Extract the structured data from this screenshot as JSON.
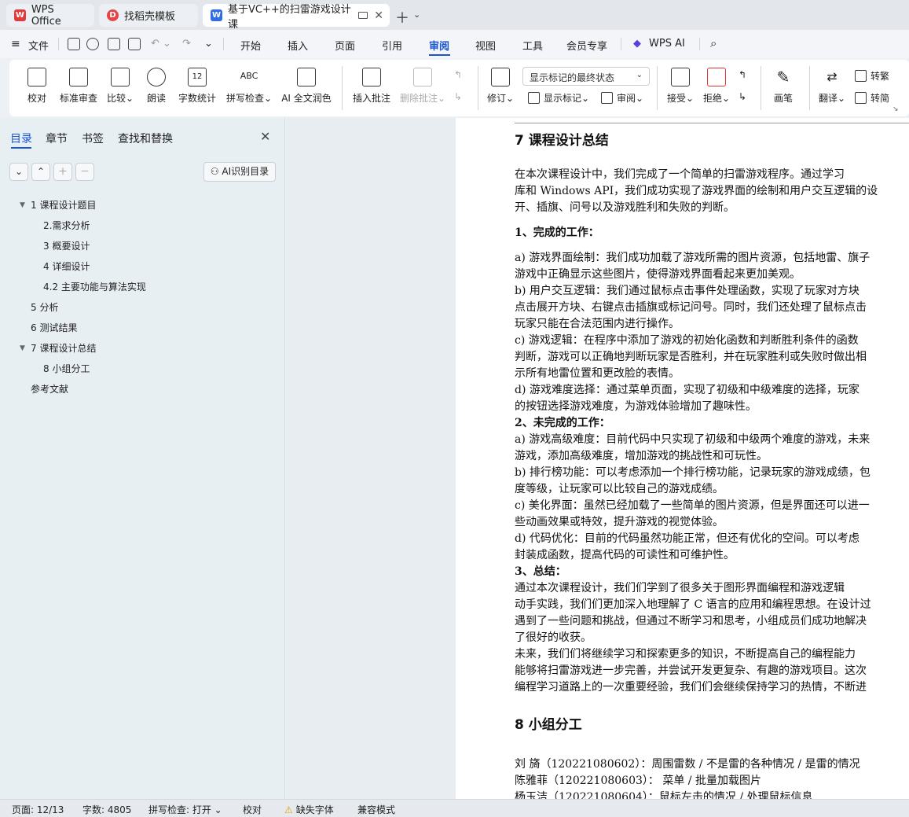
{
  "tabs": [
    {
      "label": "WPS Office",
      "logo": "W"
    },
    {
      "label": "找稻壳模板",
      "logo": "D"
    },
    {
      "label": "基于VC++的扫雷游戏设计 课",
      "logo": "W"
    }
  ],
  "menu": {
    "file": "文件",
    "items": [
      "开始",
      "插入",
      "页面",
      "引用",
      "审阅",
      "视图",
      "工具",
      "会员专享"
    ],
    "selected": "审阅",
    "ai": "WPS AI"
  },
  "ribbon": {
    "buttons": [
      {
        "label": "校对",
        "icon": "proofread-icon"
      },
      {
        "label": "标准审查",
        "icon": "standard-review-icon"
      },
      {
        "label": "比较",
        "icon": "compare-icon"
      },
      {
        "label": "朗读",
        "icon": "read-aloud-icon"
      },
      {
        "label": "字数统计",
        "icon": "word-count-icon"
      },
      {
        "label": "拼写检查",
        "icon": "spell-check-icon"
      },
      {
        "label": "AI 全文润色",
        "icon": "ai-polish-icon"
      },
      {
        "label": "插入批注",
        "icon": "insert-comment-icon"
      },
      {
        "label": "删除批注",
        "icon": "delete-comment-icon"
      }
    ],
    "dropdown_value": "显示标记的最终状态",
    "revise": "修订",
    "show_markup": "显示标记",
    "review": "审阅",
    "accept": "接受",
    "reject": "拒绝",
    "pen": "画笔",
    "translate": "翻译",
    "to_traditional": "转繁",
    "to_simplified": "转简",
    "icon_text": "ABC",
    "count_icon_text": "12"
  },
  "sidebar": {
    "tabs": [
      "目录",
      "章节",
      "书签",
      "查找和替换"
    ],
    "ai_button": "AI识别目录",
    "toc": [
      {
        "label": "1  课程设计题目",
        "level": 1,
        "expanded": true
      },
      {
        "label": "2.需求分析",
        "level": 2
      },
      {
        "label": "3  概要设计",
        "level": 2
      },
      {
        "label": "4 详细设计",
        "level": 2
      },
      {
        "label": "4.2  主要功能与算法实现",
        "level": 2
      },
      {
        "label": "5  分析",
        "level": 1
      },
      {
        "label": "6  测试结果",
        "level": 1
      },
      {
        "label": "7   课程设计总结",
        "level": 1,
        "expanded": true
      },
      {
        "label": "8  小组分工",
        "level": 2
      },
      {
        "label": "参考文献",
        "level": 1
      }
    ]
  },
  "document": {
    "heading7": "7   课程设计总结",
    "lines": [
      "     在本次课程设计中，我们完成了一个简单的扫雷游戏程序。通过学习",
      "库和 Windows API，我们成功实现了游戏界面的绘制和用户交互逻辑的设",
      "开、插旗、问号以及游戏胜利和失败的判断。",
      "1、完成的工作：",
      "a) 游戏界面绘制：我们成功加载了游戏所需的图片资源，包括地雷、旗子",
      "游戏中正确显示这些图片，使得游戏界面看起来更加美观。",
      "b) 用户交互逻辑：我们通过鼠标点击事件处理函数，实现了玩家对方块",
      "点击展开方块、右键点击插旗或标记问号。同时，我们还处理了鼠标点击",
      "玩家只能在合法范围内进行操作。",
      "c) 游戏逻辑：在程序中添加了游戏的初始化函数和判断胜利条件的函数",
      "判断，游戏可以正确地判断玩家是否胜利，并在玩家胜利或失败时做出相",
      "示所有地雷位置和更改脸的表情。",
      "d) 游戏难度选择：通过菜单页面，实现了初级和中级难度的选择，玩家",
      "的按钮选择游戏难度，为游戏体验增加了趣味性。",
      "2、未完成的工作：",
      "a) 游戏高级难度：目前代码中只实现了初级和中级两个难度的游戏，未来",
      "游戏，添加高级难度，增加游戏的挑战性和可玩性。",
      "b) 排行榜功能：可以考虑添加一个排行榜功能，记录玩家的游戏成绩，包",
      "度等级，让玩家可以比较自己的游戏成绩。",
      "c) 美化界面：虽然已经加载了一些简单的图片资源，但是界面还可以进一",
      "些动画效果或特效，提升游戏的视觉体验。",
      "d) 代码优化：目前的代码虽然功能正常，但还有优化的空间。可以考虑",
      "封装成函数，提高代码的可读性和可维护性。",
      "3、总结：",
      "     通过本次课程设计，我们们学到了很多关于图形界面编程和游戏逻辑",
      "动手实践，我们们更加深入地理解了 C 语言的应用和编程思想。在设计过",
      "遇到了一些问题和挑战，但通过不断学习和思考，小组成员们成功地解决",
      "了很好的收获。",
      "  未来，我们们将继续学习和探索更多的知识，不断提高自己的编程能力",
      "能够将扫雷游戏进一步完善，并尝试开发更复杂、有趣的游戏项目。这次",
      "编程学习道路上的一次重要经验，我们们会继续保持学习的热情，不断进"
    ],
    "heading8": "8  小组分工",
    "members": [
      "刘    旖（120221080602）：周围雷数 / 不是雷的各种情况 / 是雷的情况",
      "陈雅菲（120221080603）：         菜单 / 批量加载图片",
      "杨玉洁（120221080604）：鼠标左击的情况 / 处理鼠标信息"
    ]
  },
  "status": {
    "page": "页面: 12/13",
    "words": "字数: 4805",
    "spell": "拼写检查: 打开",
    "proof": "校对",
    "missing_font": "缺失字体",
    "compat": "兼容模式"
  },
  "colors": {
    "accent": "#1a55d0",
    "wps_red": "#e23a3a",
    "docer_red": "#e64545",
    "writer_blue": "#2f6ce5"
  }
}
